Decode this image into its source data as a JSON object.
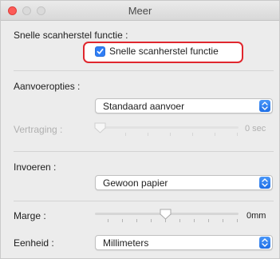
{
  "window": {
    "title": "Meer"
  },
  "quick_scan": {
    "section_label": "Snelle scanherstel functie :",
    "checkbox_label": "Snelle scanherstel functie",
    "checked": true
  },
  "feed": {
    "section_label": "Aanvoeropties :",
    "selected": "Standaard aanvoer",
    "delay_label": "Vertraging :",
    "delay_value": "0 sec"
  },
  "input": {
    "section_label": "Invoeren :",
    "selected": "Gewoon papier"
  },
  "margin": {
    "label": "Marge :",
    "value": "0mm"
  },
  "unit": {
    "label": "Eenheid :",
    "selected": "Millimeters"
  },
  "colors": {
    "highlight": "#e0272e",
    "accent": "#2f7ef6"
  },
  "icons": [
    "close-icon",
    "minimize-icon",
    "zoom-icon",
    "checkmark-icon",
    "popup-arrows-icon",
    "slider-thumb-icon"
  ]
}
